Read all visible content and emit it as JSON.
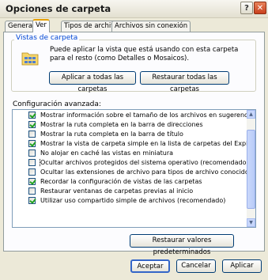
{
  "window": {
    "title": "Opciones de carpeta",
    "help_glyph": "?",
    "close_glyph": "✕"
  },
  "tabs": [
    "General",
    "Ver",
    "Tipos de archivo",
    "Archivos sin conexión"
  ],
  "folder_views": {
    "group_title": "Vistas de carpeta",
    "description": "Puede aplicar la vista que está usando con esta carpeta para el resto (como Detalles o Mosaicos).",
    "apply_all_label": "Aplicar a todas las carpetas",
    "reset_all_label": "Restaurar todas las carpetas"
  },
  "advanced": {
    "label": "Configuración avanzada:",
    "items": [
      {
        "text": "Mostrar información sobre el tamaño de los archivos en sugerencia",
        "checked": true
      },
      {
        "text": "Mostrar la ruta completa en la barra de direcciones",
        "checked": true
      },
      {
        "text": "Mostrar la ruta completa en la barra de título",
        "checked": false
      },
      {
        "text": "Mostrar la vista de carpeta simple en la lista de carpetas del Explor",
        "checked": true
      },
      {
        "text": "No alojar en caché las vistas en miniatura",
        "checked": false
      },
      {
        "text": "Ocultar archivos protegidos del sistema operativo (recomendado)",
        "checked": false,
        "selected": true
      },
      {
        "text": "Ocultar las extensiones de archivo para tipos de archivo conocido",
        "checked": false
      },
      {
        "text": "Recordar la configuración de vistas de las carpetas",
        "checked": true
      },
      {
        "text": "Restaurar ventanas de carpetas previas al inicio",
        "checked": false
      },
      {
        "text": "Utilizar uso compartido simple de archivos (recomendado)",
        "checked": true
      }
    ]
  },
  "restore_defaults_label": "Restaurar valores predeterminados",
  "footer": {
    "ok_label": "Aceptar",
    "cancel_label": "Cancelar",
    "apply_label": "Aplicar"
  }
}
